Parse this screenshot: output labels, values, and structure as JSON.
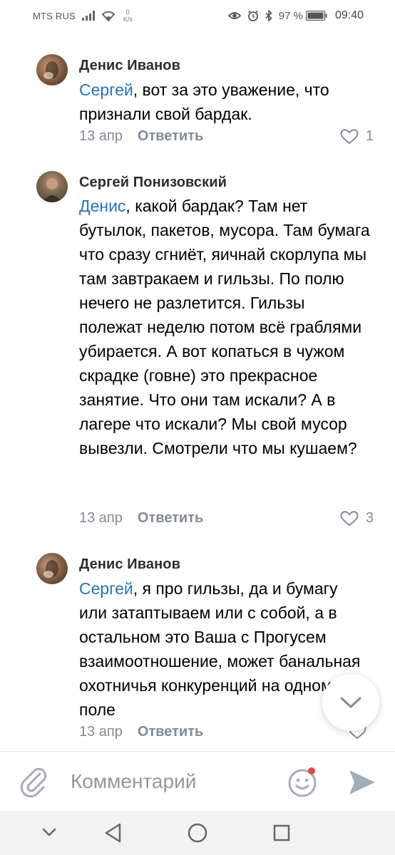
{
  "status_bar": {
    "carrier": "MTS RUS",
    "speed_value": "0",
    "speed_unit": "K/s",
    "battery": "97 %",
    "time": "09:40"
  },
  "comments": [
    {
      "author": "Денис Иванов",
      "mention": "Сергей",
      "body": ", вот за это уважение, что признали свой бардак.",
      "date": "13 апр",
      "reply_label": "Ответить",
      "likes": "1"
    },
    {
      "author": "Сергей Понизовский",
      "mention": "Денис",
      "body": ", какой бардак? Там нет бутылок, пакетов, мусора. Там бумага что сразу сгниёт, яичнай скорлупа мы там завтракаем и гильзы. По полю нечего не разлетится. Гильзы полежат неделю потом всё граблями убирается. А вот копаться в чужом скрадке (говне) это прекрасное занятие. Что они там искали? А в лагере что искали? Мы свой мусор вывезли. Смотрели что мы кушаем?",
      "date": "13 апр",
      "reply_label": "Ответить",
      "likes": "3"
    },
    {
      "author": "Денис Иванов",
      "mention": "Сергей",
      "body": ", я про гильзы, да и бумагу или затаптываем или с собой, а в остальном это Ваша с Прогусем взаимоотношение, может банальная охотничья конкуренций на одном поле",
      "date": "13 апр",
      "reply_label": "Ответить",
      "likes": ""
    }
  ],
  "input": {
    "placeholder": "Комментарий"
  },
  "icons": {
    "attach": "paperclip-icon",
    "emoji": "smiley-icon",
    "send": "send-arrow-icon",
    "scroll": "chevron-down-icon"
  },
  "colors": {
    "mention": "#2a72bf",
    "meta": "#818c99",
    "emoji_dot": "#e64646"
  }
}
